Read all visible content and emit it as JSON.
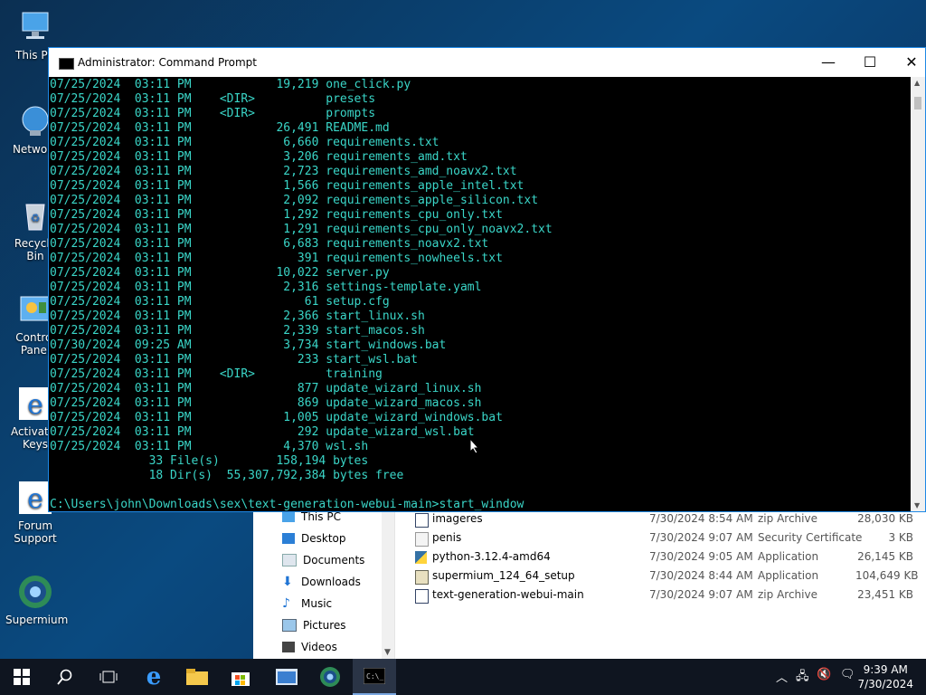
{
  "desktop": {
    "icons": [
      {
        "label": "This PC"
      },
      {
        "label": "Network"
      },
      {
        "label": "Recycle Bin"
      },
      {
        "label": "Control Panel"
      },
      {
        "label": "Activator Keys"
      },
      {
        "label": "Forum Support"
      },
      {
        "label": "Supermium"
      }
    ]
  },
  "cmd": {
    "title": "Administrator: Command Prompt",
    "lines": [
      "07/25/2024  03:11 PM            19,219 one_click.py",
      "07/25/2024  03:11 PM    <DIR>          presets",
      "07/25/2024  03:11 PM    <DIR>          prompts",
      "07/25/2024  03:11 PM            26,491 README.md",
      "07/25/2024  03:11 PM             6,660 requirements.txt",
      "07/25/2024  03:11 PM             3,206 requirements_amd.txt",
      "07/25/2024  03:11 PM             2,723 requirements_amd_noavx2.txt",
      "07/25/2024  03:11 PM             1,566 requirements_apple_intel.txt",
      "07/25/2024  03:11 PM             2,092 requirements_apple_silicon.txt",
      "07/25/2024  03:11 PM             1,292 requirements_cpu_only.txt",
      "07/25/2024  03:11 PM             1,291 requirements_cpu_only_noavx2.txt",
      "07/25/2024  03:11 PM             6,683 requirements_noavx2.txt",
      "07/25/2024  03:11 PM               391 requirements_nowheels.txt",
      "07/25/2024  03:11 PM            10,022 server.py",
      "07/25/2024  03:11 PM             2,316 settings-template.yaml",
      "07/25/2024  03:11 PM                61 setup.cfg",
      "07/25/2024  03:11 PM             2,366 start_linux.sh",
      "07/25/2024  03:11 PM             2,339 start_macos.sh",
      "07/30/2024  09:25 AM             3,734 start_windows.bat",
      "07/25/2024  03:11 PM               233 start_wsl.bat",
      "07/25/2024  03:11 PM    <DIR>          training",
      "07/25/2024  03:11 PM               877 update_wizard_linux.sh",
      "07/25/2024  03:11 PM               869 update_wizard_macos.sh",
      "07/25/2024  03:11 PM             1,005 update_wizard_windows.bat",
      "07/25/2024  03:11 PM               292 update_wizard_wsl.bat",
      "07/25/2024  03:11 PM             4,370 wsl.sh",
      "              33 File(s)        158,194 bytes",
      "              18 Dir(s)  55,307,792,384 bytes free",
      "",
      "C:\\Users\\john\\Downloads\\sex\\text-generation-webui-main>start_window"
    ]
  },
  "explorer": {
    "nav": [
      {
        "label": "This PC"
      },
      {
        "label": "Desktop"
      },
      {
        "label": "Documents"
      },
      {
        "label": "Downloads"
      },
      {
        "label": "Music"
      },
      {
        "label": "Pictures"
      },
      {
        "label": "Videos"
      }
    ],
    "files": [
      {
        "name": "imageres",
        "date": "7/30/2024 8:54 AM",
        "type": "zip Archive",
        "size": "28,030 KB"
      },
      {
        "name": "penis",
        "date": "7/30/2024 9:07 AM",
        "type": "Security Certificate",
        "size": "3 KB"
      },
      {
        "name": "python-3.12.4-amd64",
        "date": "7/30/2024 9:05 AM",
        "type": "Application",
        "size": "26,145 KB"
      },
      {
        "name": "supermium_124_64_setup",
        "date": "7/30/2024 8:44 AM",
        "type": "Application",
        "size": "104,649 KB"
      },
      {
        "name": "text-generation-webui-main",
        "date": "7/30/2024 9:07 AM",
        "type": "zip Archive",
        "size": "23,451 KB"
      }
    ]
  },
  "taskbar": {
    "time": "9:39 AM",
    "date": "7/30/2024"
  }
}
